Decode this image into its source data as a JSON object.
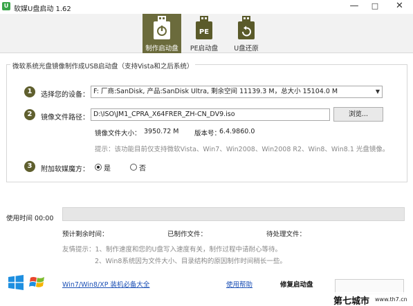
{
  "window": {
    "title": "软媒U盘启动 1.62",
    "minimize": "—",
    "maximize": "□",
    "close": "✕"
  },
  "toolbar": {
    "tabs": [
      {
        "label": "制作启动盘",
        "icon": "usb-power-icon",
        "active": true
      },
      {
        "label": "PE启动盘",
        "icon": "usb-pe-icon",
        "active": false
      },
      {
        "label": "U盘还原",
        "icon": "usb-restore-icon",
        "active": false
      }
    ]
  },
  "group": {
    "title": "微软系统光盘镜像制作成USB启动盘（支持Vista和之后系统）"
  },
  "step1": {
    "num": "1",
    "label": "选择您的设备：",
    "device": "F: 厂商:SanDisk, 产品:SanDisk Ultra, 剩余空间 11139.3 M，总大小 15104.0 M"
  },
  "step2": {
    "num": "2",
    "label": "镜像文件路径：",
    "path": "D:\\ISO\\JM1_CPRA_X64FRER_ZH-CN_DV9.iso",
    "browse": "浏览..."
  },
  "image_info": {
    "size_label": "镜像文件大小：",
    "size_value": "3950.72 M",
    "version_label": "版本号：",
    "version_value": "6.4.9860.0",
    "tip": "提示：该功能目前仅支持微软Vista、Win7、Win2008、Win2008 R2、Win8、Win8.1 光盘镜像。"
  },
  "step3": {
    "num": "3",
    "label": "附加软媒魔方：",
    "yes": "是",
    "no": "否",
    "selected": "yes"
  },
  "progress": {
    "time_label": "使用时间 00:00",
    "remaining_label": "预计剩余时间：",
    "made_label": "已制作文件：",
    "pending_label": "待处理文件："
  },
  "notes": {
    "line1": "友情提示：1、制作速度和您的U盘写入速度有关，制作过程中请耐心等待。",
    "line2": "2、Win8系统因为文件大小、目录结构的原因制作时间稍长一些。"
  },
  "footer": {
    "win_link": "Win7/Win8/XP 装机必备大全",
    "help": "使用帮助",
    "repair": "修复启动盘"
  },
  "watermark": {
    "text": "第七城市",
    "url": "www.th7.cn"
  },
  "colors": {
    "accent": "#6b6b3c",
    "step_circle": "#5f5f2e",
    "link": "#1a4fb5"
  }
}
